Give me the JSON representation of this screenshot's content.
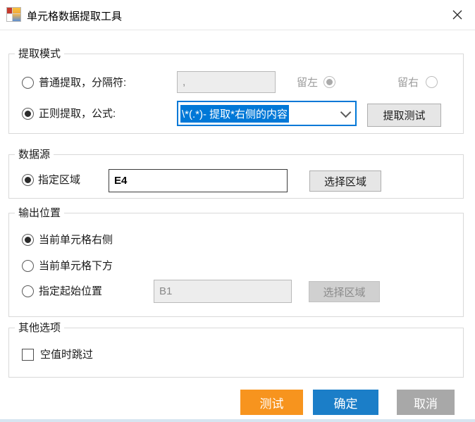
{
  "window": {
    "title": "单元格数据提取工具"
  },
  "extract_mode": {
    "legend": "提取模式",
    "normal_radio_label": "普通提取，分隔符:",
    "separator_value": ",",
    "keep_left_label": "留左",
    "keep_right_label": "留右",
    "regex_radio_label": "正则提取，公式:",
    "formula_value": "\\*(.*)- 提取*右侧的内容",
    "extract_test_button": "提取测试"
  },
  "data_source": {
    "legend": "数据源",
    "region_radio_label": "指定区域",
    "region_value": "E4",
    "select_region_button": "选择区域"
  },
  "output_position": {
    "legend": "输出位置",
    "right_radio_label": "当前单元格右侧",
    "below_radio_label": "当前单元格下方",
    "start_radio_label": "指定起始位置",
    "start_value": "B1",
    "select_region_button": "选择区域"
  },
  "other_options": {
    "legend": "其他选项",
    "skip_empty_label": "空值时跳过"
  },
  "footer": {
    "test_button": "测试",
    "ok_button": "确定",
    "cancel_button": "取消"
  },
  "colors": {
    "accent_orange": "#F7941E",
    "accent_blue": "#1B7EC8",
    "cancel_gray": "#A8A8A8",
    "selection_blue": "#0078D7"
  }
}
